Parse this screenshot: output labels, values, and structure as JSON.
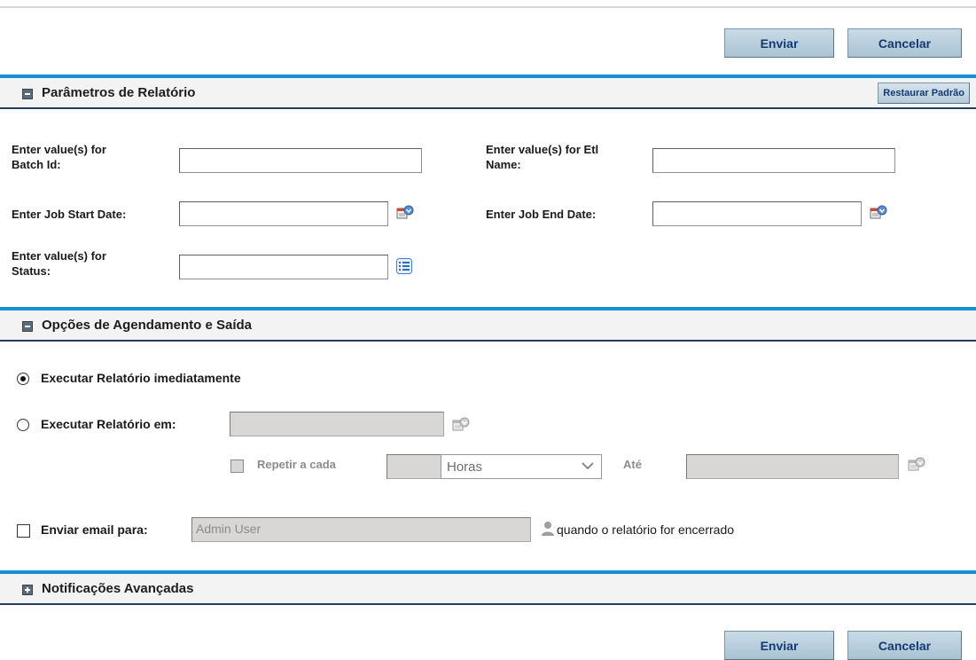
{
  "toolbar": {
    "submit_label": "Enviar",
    "cancel_label": "Cancelar"
  },
  "report_params": {
    "title": "Parâmetros de Relatório",
    "restore_label": "Restaurar Padrão",
    "batch_id_label_line1": "Enter value(s) for",
    "batch_id_label_line2": "Batch Id:",
    "batch_id_value": "",
    "etl_name_label_line1": "Enter value(s) for Etl",
    "etl_name_label_line2": "Name:",
    "etl_name_value": "",
    "job_start_label": "Enter Job Start Date:",
    "job_start_value": "",
    "job_end_label": "Enter Job End Date:",
    "job_end_value": "",
    "status_label_line1": "Enter value(s) for",
    "status_label_line2": "Status:",
    "status_value": ""
  },
  "schedule": {
    "title": "Opções de Agendamento e Saída",
    "run_now_label": "Executar Relatório imediatamente",
    "run_at_label": "Executar Relatório em:",
    "run_at_value": "",
    "repeat_label": "Repetir a cada",
    "repeat_value": "",
    "repeat_unit": "Horas",
    "until_label": "Até",
    "until_value": "",
    "email_label": "Enviar email para:",
    "email_value": "Admin User",
    "email_suffix": "quando o relatório for encerrado"
  },
  "notifications": {
    "title": "Notificações Avançadas"
  },
  "colors": {
    "accent": "#1a8fd6",
    "header_rule": "#253f63",
    "button_text": "#143a73"
  }
}
